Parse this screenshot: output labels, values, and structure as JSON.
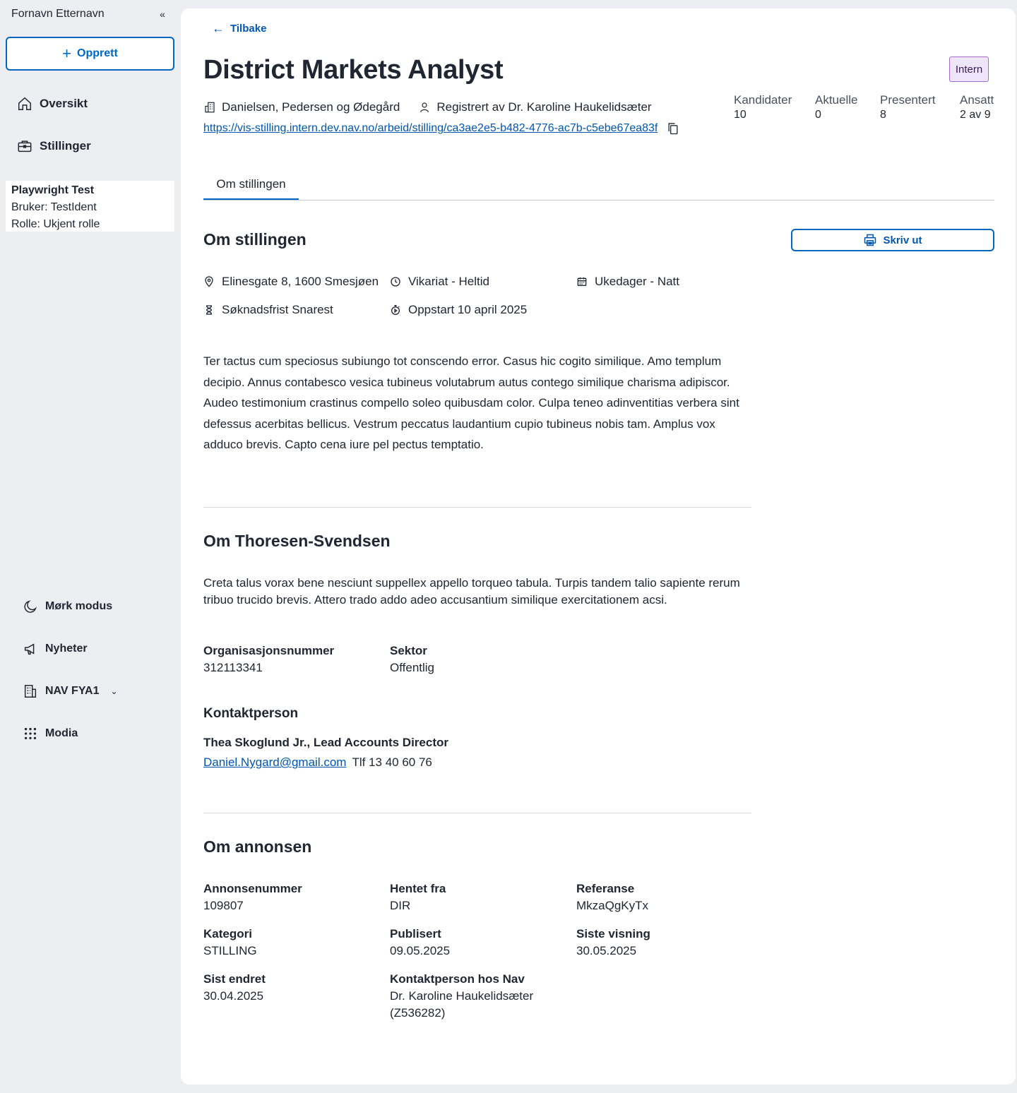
{
  "sidebar": {
    "user_name": "Fornavn Etternavn",
    "collapse_glyph": "«",
    "create_label": "Opprett",
    "nav": [
      {
        "label": "Oversikt",
        "icon": "home-icon"
      },
      {
        "label": "Stillinger",
        "icon": "briefcase-icon"
      }
    ],
    "user_info": {
      "name": "Playwright Test",
      "user": "Bruker: TestIdent",
      "role": "Rolle: Ukjent rolle"
    },
    "bottom": [
      {
        "label": "Mørk modus",
        "icon": "moon-icon"
      },
      {
        "label": "Nyheter",
        "icon": "megaphone-icon"
      },
      {
        "label": "NAV FYA1",
        "icon": "building-icon"
      },
      {
        "label": "Modia",
        "icon": "grid-icon"
      }
    ]
  },
  "header": {
    "back_label": "Tilbake",
    "title": "District Markets Analyst",
    "badge": "Intern",
    "employer": "Danielsen, Pedersen og Ødegård",
    "registered_by": "Registrert av Dr. Karoline Haukelidsæter",
    "url": "https://vis-stilling.intern.dev.nav.no/arbeid/stilling/ca3ae2e5-b482-4776-ac7b-c5ebe67ea83f",
    "stats": [
      {
        "label": "Kandidater",
        "value": "10"
      },
      {
        "label": "Aktuelle",
        "value": "0"
      },
      {
        "label": "Presentert",
        "value": "8"
      },
      {
        "label": "Ansatt",
        "value": "2 av 9"
      }
    ]
  },
  "tabs": [
    {
      "label": "Om stillingen"
    }
  ],
  "position": {
    "title": "Om stillingen",
    "print_label": "Skriv ut",
    "location": "Elinesgate 8, 1600 Smesjøen",
    "employment": "Vikariat - Heltid",
    "schedule": "Ukedager - Natt",
    "deadline": "Søknadsfrist Snarest",
    "start": "Oppstart 10 april 2025",
    "description": "Ter tactus cum speciosus subiungo tot conscendo error. Casus hic cogito similique. Amo templum decipio. Annus contabesco vesica tubineus volutabrum autus contego similique charisma adipiscor. Audeo testimonium crastinus compello soleo quibusdam color. Culpa teneo adinventitias verbera sint defessus acerbitas bellicus. Vestrum peccatus laudantium cupio tubineus nobis tam. Amplus vox adduco brevis. Capto cena iure pel pectus temptatio."
  },
  "employer": {
    "title": "Om Thoresen-Svendsen",
    "description": "Creta talus vorax bene nesciunt suppellex appello torqueo tabula. Turpis tandem talio sapiente rerum tribuo trucido brevis. Attero trado addo adeo accusantium similique exercitationem acsi.",
    "org_label": "Organisasjonsnummer",
    "org_value": "312113341",
    "sector_label": "Sektor",
    "sector_value": "Offentlig",
    "contact_title": "Kontaktperson",
    "contact_name": "Thea Skoglund Jr., Lead Accounts Director",
    "contact_email": "Daniel.Nygard@gmail.com",
    "contact_phone": "Tlf 13 40 60 76"
  },
  "ad": {
    "title": "Om annonsen",
    "fields": [
      {
        "label": "Annonsenummer",
        "value": "109807"
      },
      {
        "label": "Hentet fra",
        "value": "DIR"
      },
      {
        "label": "Referanse",
        "value": "MkzaQgKyTx"
      },
      {
        "label": "Kategori",
        "value": "STILLING"
      },
      {
        "label": "Publisert",
        "value": "09.05.2025"
      },
      {
        "label": "Siste visning",
        "value": "30.05.2025"
      },
      {
        "label": "Sist endret",
        "value": "30.04.2025"
      },
      {
        "label": "Kontaktperson hos Nav",
        "value": "Dr. Karoline Haukelidsæter",
        "value2": "(Z536282)"
      }
    ]
  },
  "colors": {
    "accent": "#0067c5",
    "link": "#0056b4",
    "badge_bg": "#efe5fa",
    "badge_border": "#a46ad9"
  }
}
